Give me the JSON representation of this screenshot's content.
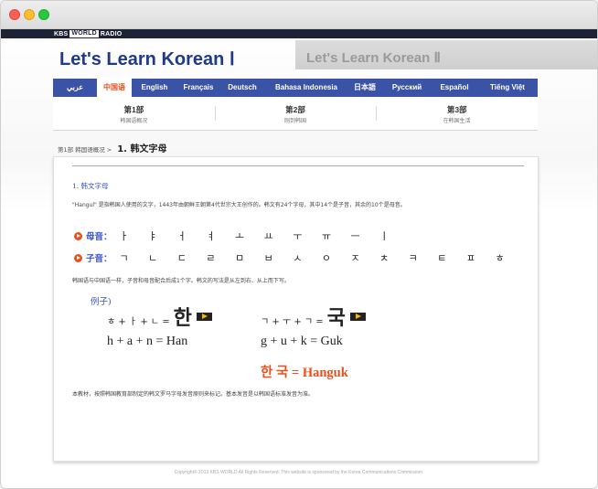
{
  "window": {
    "controls": [
      "close",
      "minimize",
      "maximize"
    ]
  },
  "header": {
    "logo_part1": "KBS",
    "logo_part2": "WORLD",
    "logo_part3": "RADIO",
    "title": "Let's Learn Korean Ⅰ",
    "title2": "Let's Learn Korean Ⅱ"
  },
  "languages": [
    {
      "label": "عربي",
      "active": false
    },
    {
      "label": "中国语",
      "active": true
    },
    {
      "label": "English",
      "active": false
    },
    {
      "label": "Français",
      "active": false
    },
    {
      "label": "Deutsch",
      "active": false
    },
    {
      "label": "Bahasa Indonesia",
      "active": false
    },
    {
      "label": "日本語",
      "active": false
    },
    {
      "label": "Русский",
      "active": false
    },
    {
      "label": "Español",
      "active": false
    },
    {
      "label": "Tiếng Việt",
      "active": false
    }
  ],
  "parts": [
    {
      "title": "第1部",
      "subtitle": "韩国语概况"
    },
    {
      "title": "第2部",
      "subtitle": "刚到韩国"
    },
    {
      "title": "第3部",
      "subtitle": "在韩国生活"
    }
  ],
  "breadcrumb": {
    "parent": "第1部 韩国语概况 >",
    "current": "1. 韩文字母"
  },
  "content": {
    "section_heading": "1. 韩文字母",
    "intro": "\"Hangul\" 是指韩国人使用的文字，1443年由朝鲜王朝第4代世宗大王创作的。韩文有24个字母，其中14个是子音，其余的10个是母音。",
    "vowels_label": "母音：",
    "vowels": "ㅏ ㅑ ㅓ ㅕ ㅗ ㅛ ㅜ ㅠ ㅡ ㅣ",
    "consonants_label": "子音：",
    "consonants": "ㄱ ㄴ ㄷ ㄹ ㅁ ㅂ ㅅ ㅇ ㅈ ㅊ ㅋ ㅌ ㅍ ㅎ",
    "combination_note": "韩国语与中国语一样，子音和母音配合后成1个字。韩文的写法是从左到右、从上而下写。",
    "example_label": "例子)",
    "example1_parts": "ㅎ + ㅏ + ㄴ =",
    "example1_syllable": "한",
    "example1_roman": "h + a + n = Han",
    "example2_parts": "ㄱ + ㅜ + ㄱ =",
    "example2_syllable": "국",
    "example2_roman": "g + u + k = Guk",
    "result": "한 국 = Hanguk",
    "footnote": "本教材，按照韩国教育部制定的韩文罗马字母发音原则来标记。基本发音是以韩国语标准发音为准。"
  },
  "footer": {
    "copyright": "Copyright© 2013 KBS WORLD All Rights Reserved. This website is sponsored by the Korea Communications Commission."
  },
  "colors": {
    "nav": "#3a53a6",
    "accent": "#e8501c",
    "title": "#1f3a8a",
    "topbar": "#1d2237"
  }
}
